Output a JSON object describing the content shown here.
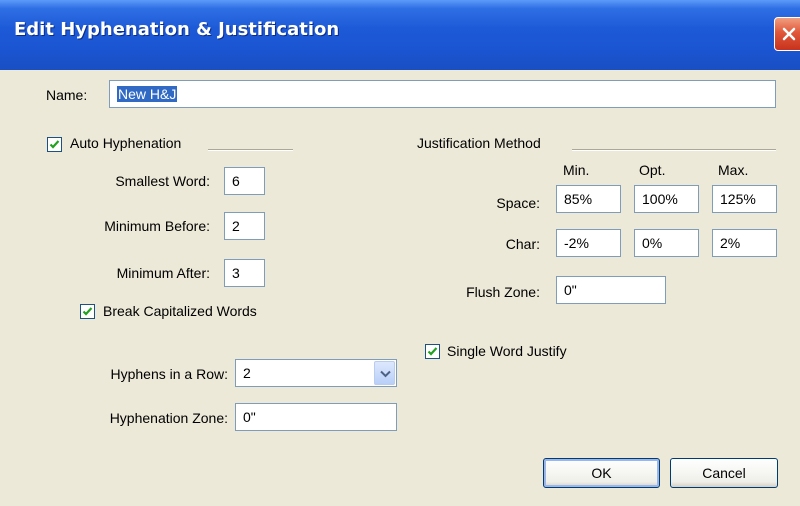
{
  "window": {
    "title": "Edit Hyphenation & Justification"
  },
  "name": {
    "label": "Name:",
    "value": "New H&J"
  },
  "auto_hyphenation": {
    "label": "Auto Hyphenation",
    "checked": true,
    "smallest_word": {
      "label": "Smallest Word:",
      "value": "6"
    },
    "minimum_before": {
      "label": "Minimum Before:",
      "value": "2"
    },
    "minimum_after": {
      "label": "Minimum After:",
      "value": "3"
    },
    "break_capitalized": {
      "label": "Break Capitalized Words",
      "checked": true
    },
    "hyphens_in_a_row": {
      "label": "Hyphens in a Row:",
      "value": "2"
    },
    "hyphenation_zone": {
      "label": "Hyphenation Zone:",
      "value": "0\""
    }
  },
  "justification": {
    "label": "Justification Method",
    "headers": {
      "min": "Min.",
      "opt": "Opt.",
      "max": "Max."
    },
    "space": {
      "label": "Space:",
      "min": "85%",
      "opt": "100%",
      "max": "125%"
    },
    "char": {
      "label": "Char:",
      "min": "-2%",
      "opt": "0%",
      "max": "2%"
    },
    "flush_zone": {
      "label": "Flush Zone:",
      "value": "0\""
    },
    "single_word_justify": {
      "label": "Single Word Justify",
      "checked": true
    }
  },
  "buttons": {
    "ok": "OK",
    "cancel": "Cancel"
  }
}
